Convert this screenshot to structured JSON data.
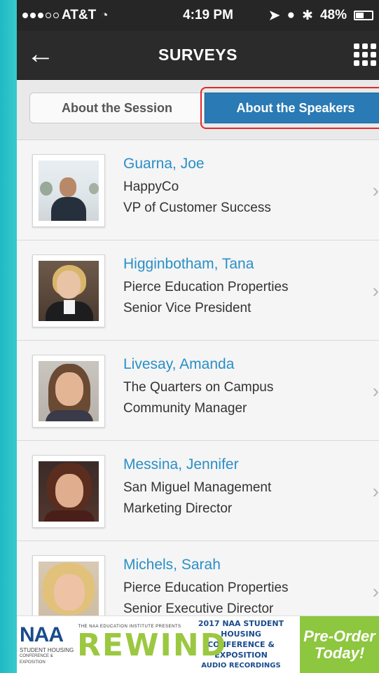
{
  "status_bar": {
    "carrier": "AT&T",
    "time": "4:19 PM",
    "battery": "48%"
  },
  "nav": {
    "title": "SURVEYS"
  },
  "segment": {
    "session_label": "About the Session",
    "speakers_label": "About the Speakers",
    "selected": "About the Speakers"
  },
  "speakers": [
    {
      "name": "Guarna, Joe",
      "company": "HappyCo",
      "title": "VP of Customer Success"
    },
    {
      "name": "Higginbotham, Tana",
      "company": "Pierce Education Properties",
      "title": "Senior Vice President"
    },
    {
      "name": "Livesay, Amanda",
      "company": "The Quarters on Campus",
      "title": "Community Manager"
    },
    {
      "name": "Messina, Jennifer",
      "company": "San Miguel Management",
      "title": "Marketing Director"
    },
    {
      "name": "Michels, Sarah",
      "company": "Pierce Education Properties",
      "title": "Senior Executive Director"
    }
  ],
  "banner": {
    "naa_logo": "NAA",
    "naa_sub_1": "STUDENT HOUSING",
    "naa_sub_2": "CONFERENCE & EXPOSITION",
    "rewind_top": "THE NAA EDUCATION INSTITUTE PRESENTS",
    "rewind_word": "REWIND",
    "conf_line1": "2017 NAA STUDENT HOUSING",
    "conf_line2": "CONFERENCE & EXPOSITION",
    "conf_line3": "AUDIO RECORDINGS",
    "cta_line1": "Pre-Order",
    "cta_line2": "Today!"
  },
  "colors": {
    "accent": "#2a7ab5",
    "name_link": "#2a8fc6",
    "highlight": "#e0282a",
    "cta": "#8dc63f"
  }
}
